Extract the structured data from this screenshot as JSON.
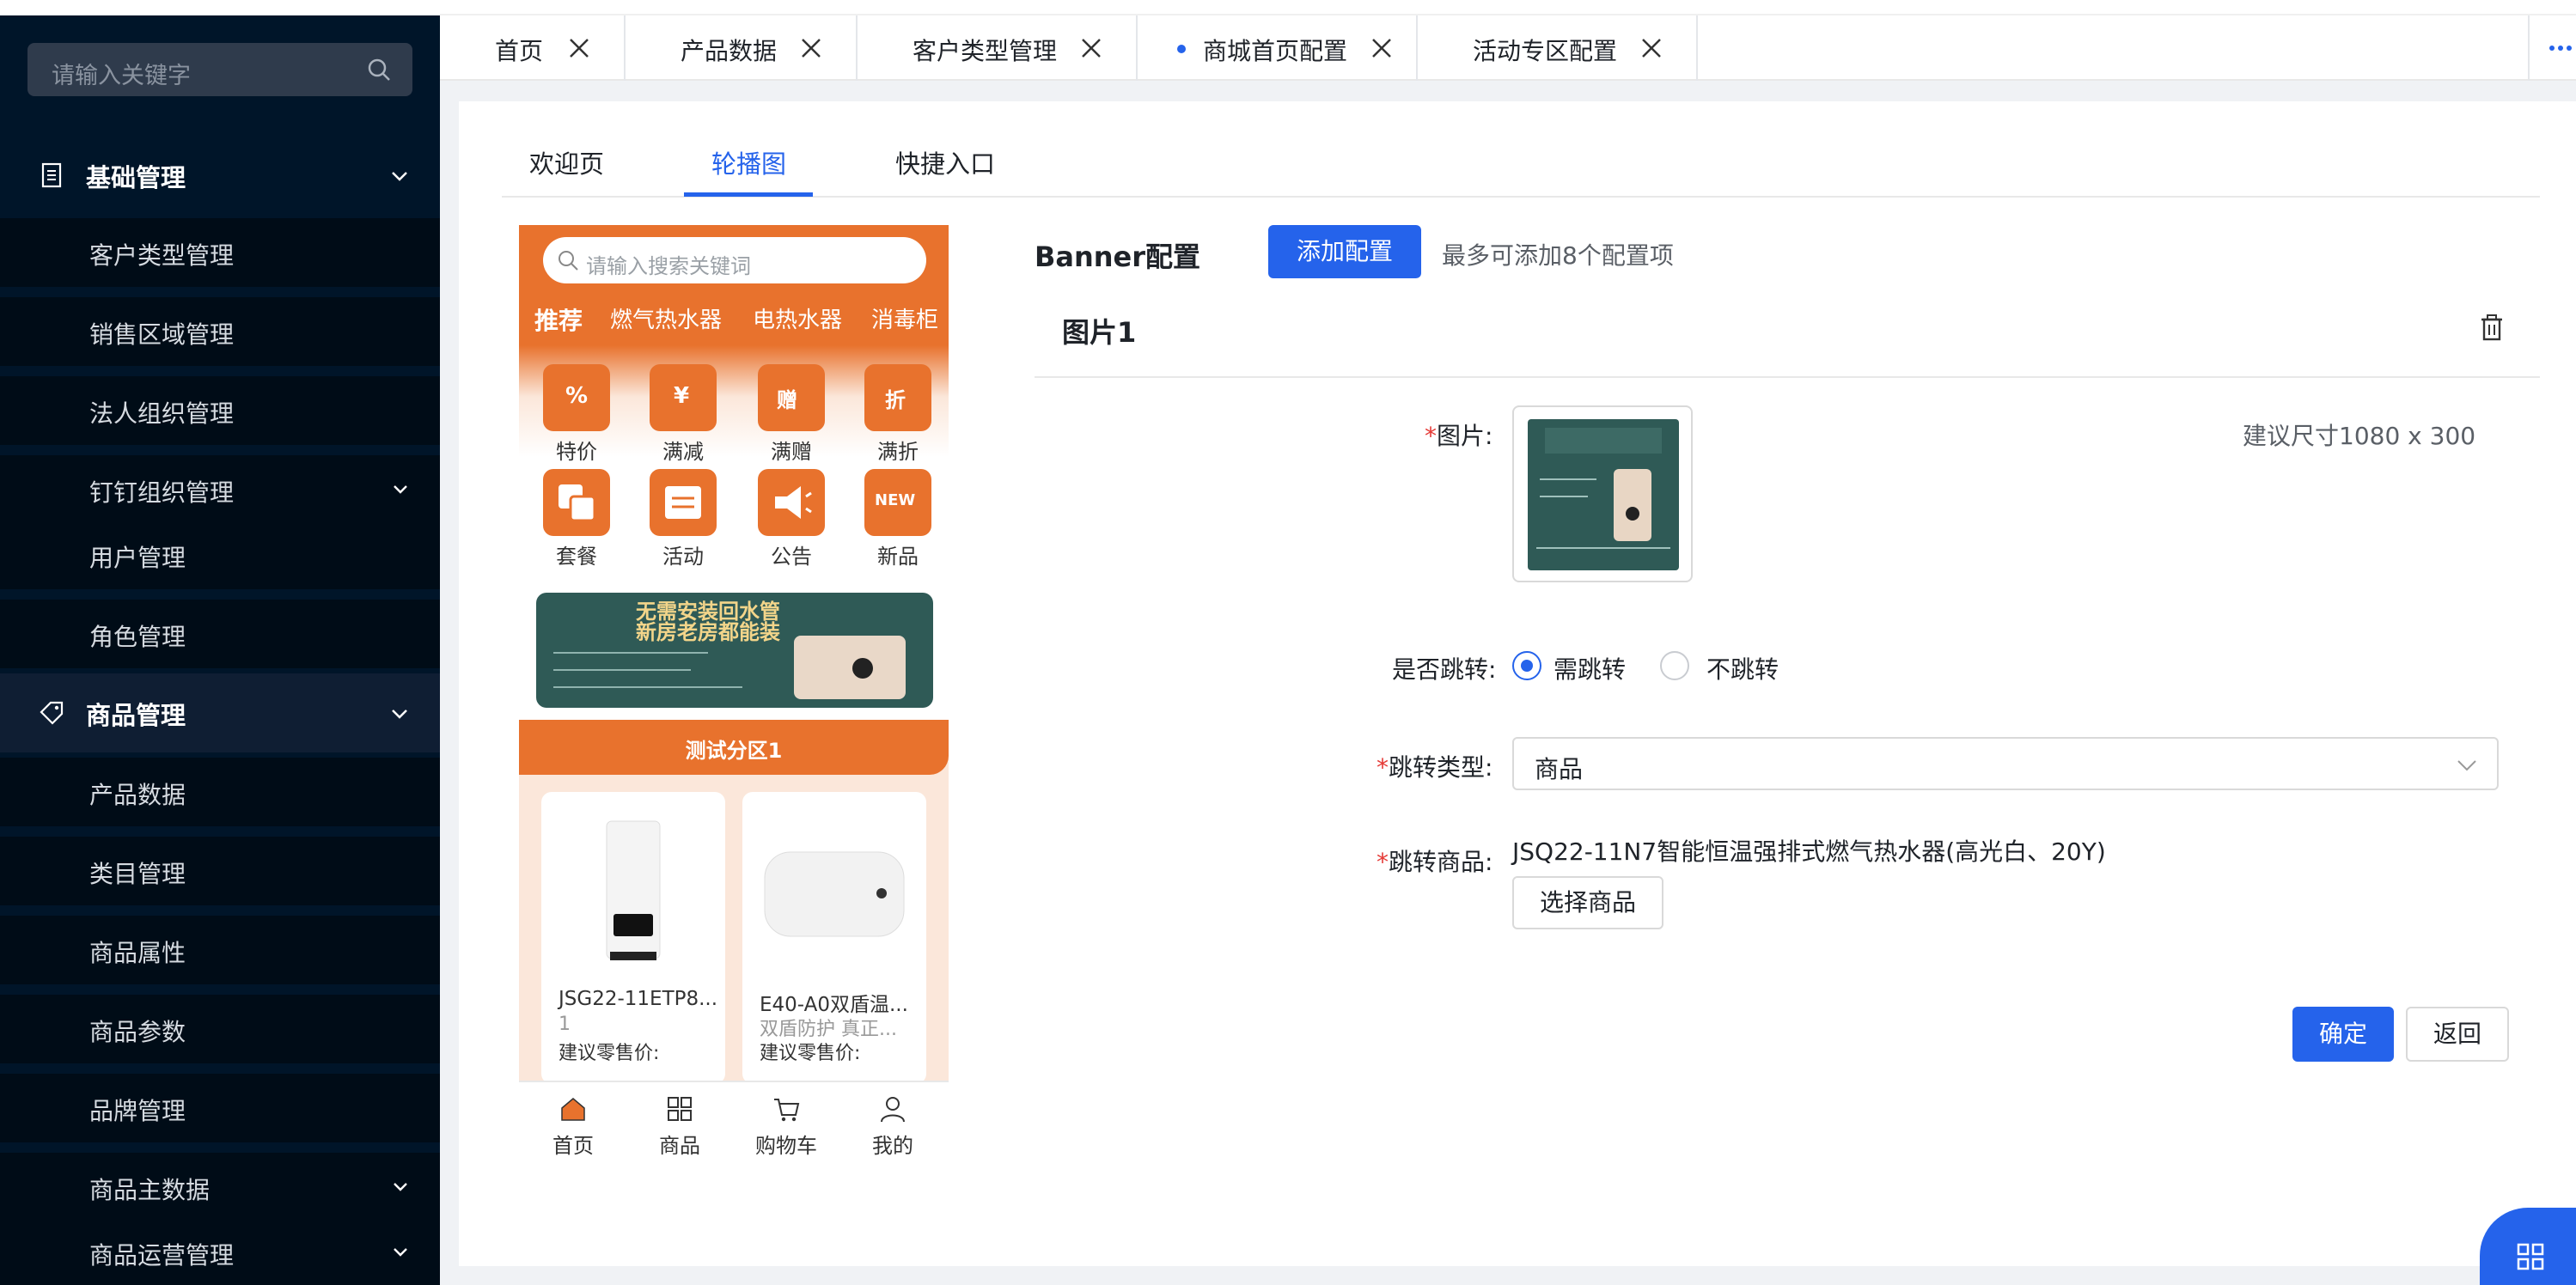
{
  "sidebar": {
    "search_placeholder": "请输入关键字",
    "groups": [
      {
        "label": "基础管理",
        "icon": "document-icon"
      },
      {
        "label": "商品管理",
        "icon": "tag-icon"
      }
    ],
    "items": [
      {
        "label": "客户类型管理"
      },
      {
        "label": "销售区域管理"
      },
      {
        "label": "法人组织管理"
      },
      {
        "label": "钉钉组织管理"
      },
      {
        "label": "用户管理"
      },
      {
        "label": "角色管理"
      },
      {
        "label": "产品数据"
      },
      {
        "label": "类目管理"
      },
      {
        "label": "商品属性"
      },
      {
        "label": "商品参数"
      },
      {
        "label": "品牌管理"
      },
      {
        "label": "商品主数据"
      },
      {
        "label": "商品运营管理"
      }
    ]
  },
  "tabs": [
    {
      "label": "首页"
    },
    {
      "label": "产品数据"
    },
    {
      "label": "客户类型管理"
    },
    {
      "label": "商城首页配置",
      "active": true
    },
    {
      "label": "活动专区配置"
    }
  ],
  "subtabs": [
    {
      "label": "欢迎页"
    },
    {
      "label": "轮播图",
      "active": true
    },
    {
      "label": "快捷入口"
    }
  ],
  "preview": {
    "search_placeholder": "请输入搜索关键词",
    "categories": [
      "推荐",
      "燃气热水器",
      "电热水器",
      "消毒柜"
    ],
    "quick_entries": [
      "特价",
      "满减",
      "满赠",
      "满折",
      "套餐",
      "活动",
      "公告",
      "新品"
    ],
    "quick_icon_glyphs": [
      "%",
      "¥",
      "赠",
      "折",
      "",
      "",
      "",
      "NEW"
    ],
    "banner_text_line1": "无需安装回水管",
    "banner_text_line2": "新房老房都能装",
    "section_title": "测试分区1",
    "products": [
      {
        "name": "JSG22-11ETP8...",
        "sub": "1",
        "price": "建议零售价:"
      },
      {
        "name": "E40-A0双盾温...",
        "sub": "双盾防护 真正...",
        "price": "建议零售价:"
      }
    ],
    "nav": [
      {
        "label": "首页",
        "icon": "home-icon"
      },
      {
        "label": "商品",
        "icon": "grid-icon"
      },
      {
        "label": "购物车",
        "icon": "cart-icon"
      },
      {
        "label": "我的",
        "icon": "user-icon"
      }
    ]
  },
  "config": {
    "title": "Banner配置",
    "add_button": "添加配置",
    "hint": "最多可添加8个配置项",
    "card_title": "图片1",
    "image_label": "图片",
    "size_hint": "建议尺寸1080 x 300",
    "jump_label": "是否跳转",
    "jump_options": [
      "需跳转",
      "不跳转"
    ],
    "jump_selected": "需跳转",
    "jump_type_label": "跳转类型",
    "jump_type_value": "商品",
    "jump_product_label": "跳转商品",
    "jump_product_value": "JSQ22-11N7智能恒温强排式燃气热水器(高光白、20Y)",
    "select_product_button": "选择商品",
    "confirm_button": "确定",
    "back_button": "返回"
  },
  "colors": {
    "primary": "#2563eb",
    "sidebar_bg": "#001529",
    "phone_accent": "#e8722d",
    "required": "#e53935"
  }
}
